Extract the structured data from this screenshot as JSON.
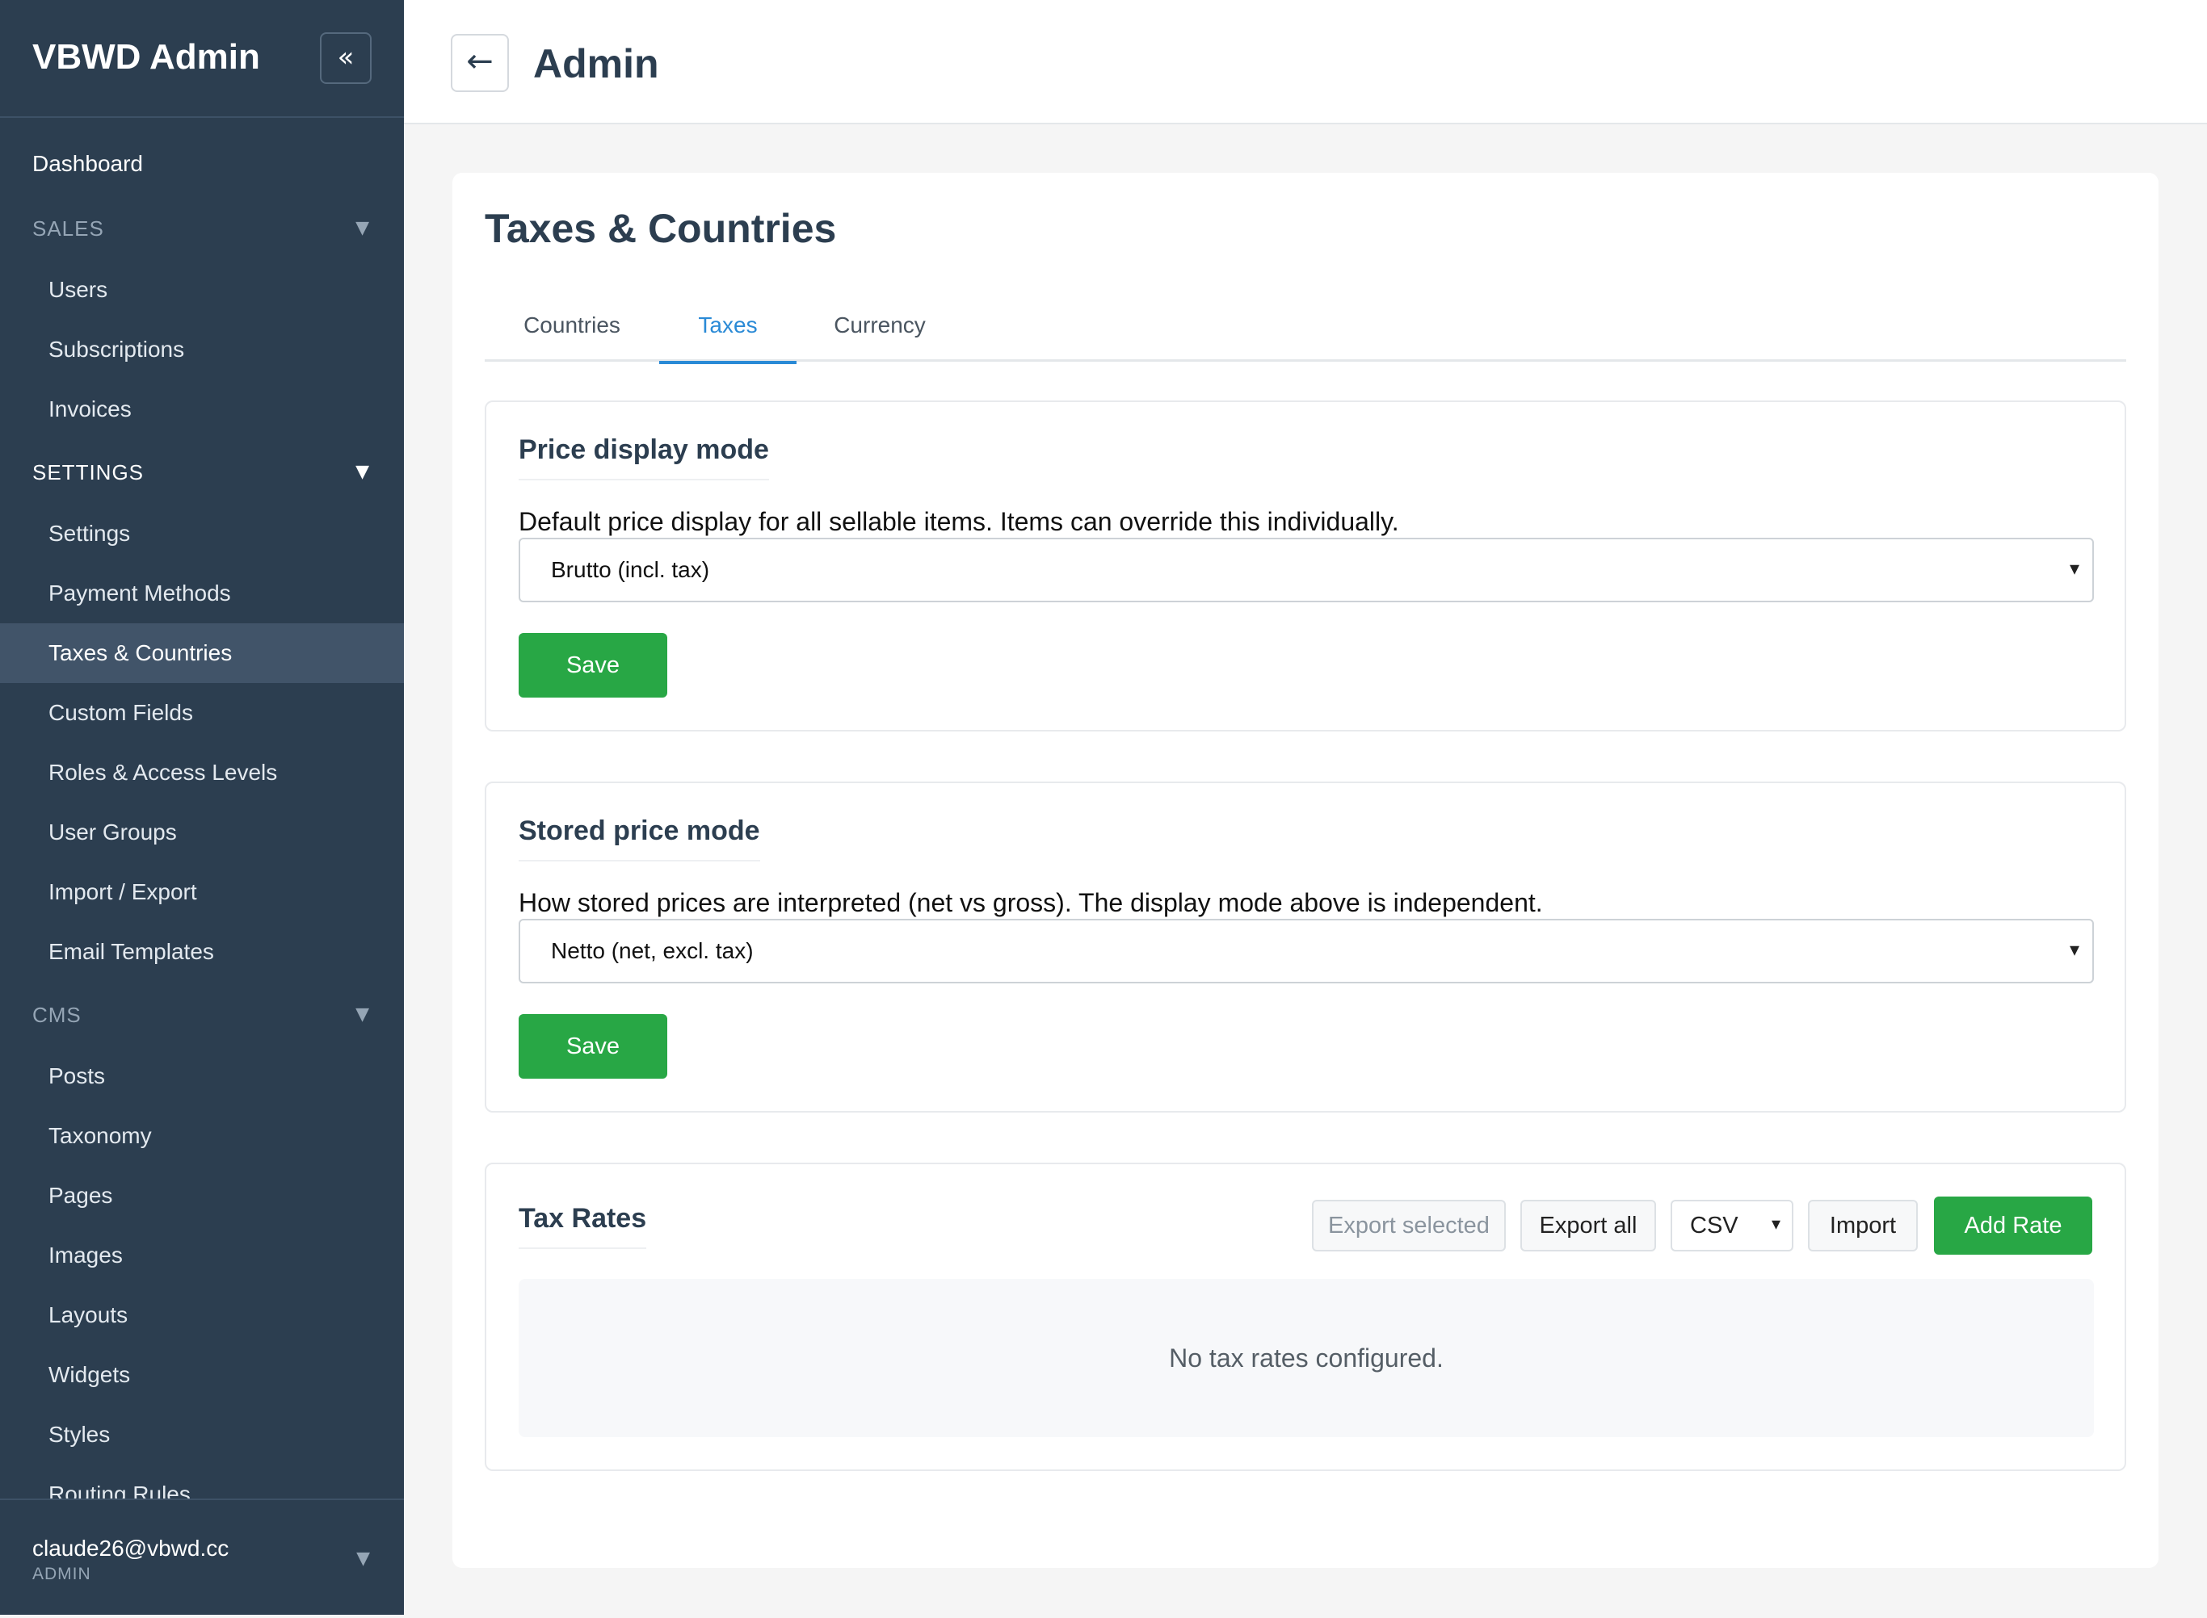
{
  "sidebar": {
    "brand": "VBWD Admin",
    "collapse_icon": "«",
    "dashboard": "Dashboard",
    "sections": {
      "sales": {
        "label": "SALES",
        "items": [
          "Users",
          "Subscriptions",
          "Invoices"
        ]
      },
      "settings": {
        "label": "SETTINGS",
        "items": [
          "Settings",
          "Payment Methods",
          "Taxes & Countries",
          "Custom Fields",
          "Roles & Access Levels",
          "User Groups",
          "Import / Export",
          "Email Templates"
        ]
      },
      "cms": {
        "label": "CMS",
        "items": [
          "Posts",
          "Taxonomy",
          "Pages",
          "Images",
          "Layouts",
          "Widgets",
          "Styles",
          "Routing Rules"
        ]
      }
    },
    "active_item": "Taxes & Countries",
    "caret": "▼",
    "user": {
      "email": "claude26@vbwd.cc",
      "role": "ADMIN"
    }
  },
  "header": {
    "back_icon": "←",
    "title": "Admin"
  },
  "main": {
    "title": "Taxes & Countries",
    "tabs": [
      "Countries",
      "Taxes",
      "Currency"
    ],
    "active_tab": "Taxes",
    "price_display": {
      "title": "Price display mode",
      "description": "Default price display for all sellable items. Items can override this individually.",
      "selected": "Brutto (incl. tax)",
      "save_label": "Save"
    },
    "stored_price": {
      "title": "Stored price mode",
      "description": "How stored prices are interpreted (net vs gross). The display mode above is independent.",
      "selected": "Netto (net, excl. tax)",
      "save_label": "Save"
    },
    "tax_rates": {
      "title": "Tax Rates",
      "export_selected": "Export selected",
      "export_all": "Export all",
      "format": "CSV",
      "import": "Import",
      "add_rate": "Add Rate",
      "empty_message": "No tax rates configured."
    },
    "select_chevron": "⌄"
  },
  "colors": {
    "sidebar_bg": "#2c3e50",
    "accent": "#2a8ad6",
    "success": "#28a745"
  }
}
